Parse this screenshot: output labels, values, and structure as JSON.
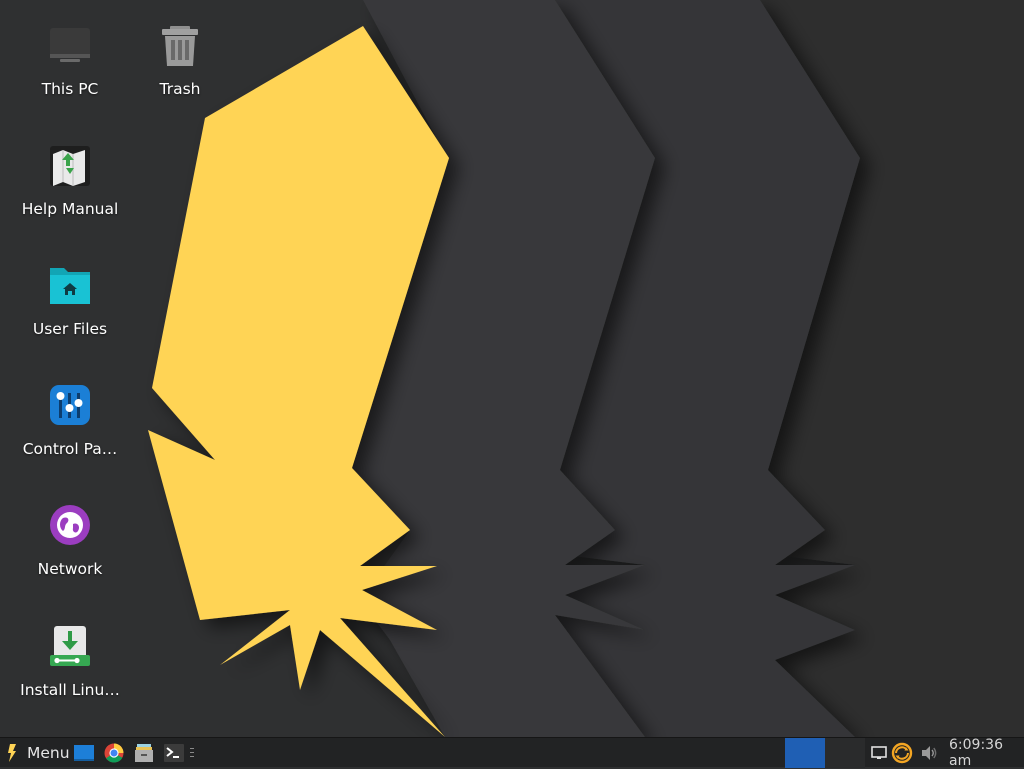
{
  "desktop": {
    "icons": [
      {
        "label": "This PC",
        "icon": "computer-icon"
      },
      {
        "label": "Trash",
        "icon": "trash-icon"
      },
      {
        "label": "Help Manual",
        "icon": "map-icon"
      },
      {
        "label": "User Files",
        "icon": "home-folder-icon"
      },
      {
        "label": "Control Pa…",
        "icon": "sliders-icon"
      },
      {
        "label": "Network",
        "icon": "globe-icon"
      },
      {
        "label": "Install Linu…",
        "icon": "install-icon"
      }
    ]
  },
  "taskbar": {
    "menu_label": "Menu",
    "launchers": [
      "show-desktop-icon",
      "chrome-icon",
      "file-manager-icon",
      "terminal-icon"
    ],
    "clock": "6:09:36 am",
    "tray": [
      "display-icon",
      "update-icon",
      "volume-icon"
    ]
  },
  "colors": {
    "wallpaper_yellow": "#ffd455",
    "background": "#2f3031",
    "taskbar": "#222324",
    "workspace_active": "#1f5fb4"
  }
}
